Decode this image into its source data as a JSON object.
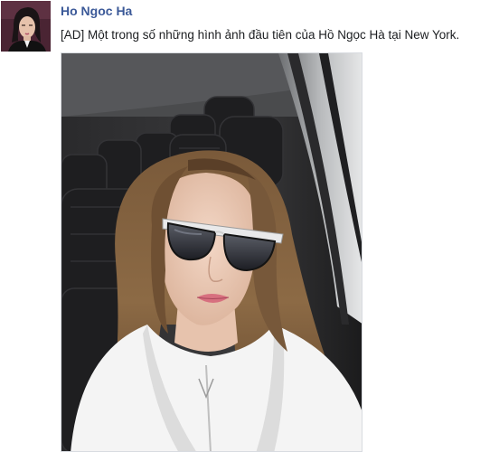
{
  "post": {
    "author_name": "Ho Ngoc Ha",
    "caption": "[AD] Một trong số những hình ảnh đầu tiên của Hồ Ngọc Hà tại New York."
  },
  "colors": {
    "author_link": "#3b5998",
    "text": "#1c1e21",
    "background": "#ffffff"
  }
}
